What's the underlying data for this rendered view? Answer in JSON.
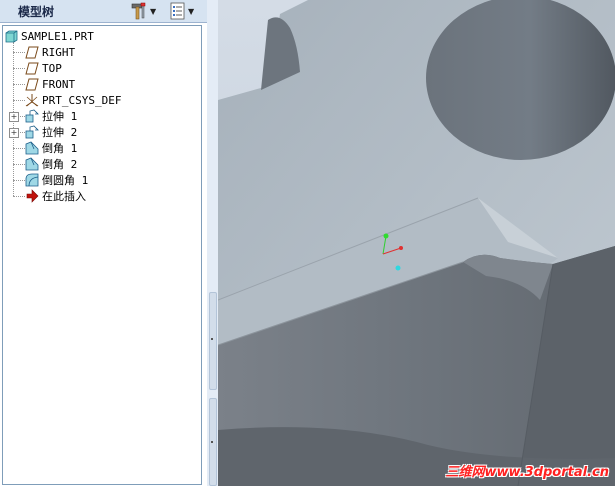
{
  "panel": {
    "title": "模型树",
    "tools_icon": "hammer-tools-icon",
    "settings_icon": "tree-settings-icon"
  },
  "tree": {
    "root": {
      "label": "SAMPLE1.PRT",
      "icon": "part-icon"
    },
    "items": [
      {
        "label": "RIGHT",
        "icon": "datum-plane-icon",
        "expandable": false
      },
      {
        "label": "TOP",
        "icon": "datum-plane-icon",
        "expandable": false
      },
      {
        "label": "FRONT",
        "icon": "datum-plane-icon",
        "expandable": false
      },
      {
        "label": "PRT_CSYS_DEF",
        "icon": "coordinate-system-icon",
        "expandable": false
      },
      {
        "label": "拉伸 1",
        "icon": "extrude-icon",
        "expandable": true
      },
      {
        "label": "拉伸 2",
        "icon": "extrude-icon",
        "expandable": true
      },
      {
        "label": "倒角 1",
        "icon": "chamfer-icon",
        "expandable": false
      },
      {
        "label": "倒角 2",
        "icon": "chamfer-icon",
        "expandable": false
      },
      {
        "label": "倒圆角 1",
        "icon": "round-icon",
        "expandable": false
      },
      {
        "label": "在此插入",
        "icon": "insert-here-arrow-icon",
        "expandable": false
      }
    ]
  },
  "colors": {
    "panel_header": "#d6e3f1",
    "model_top_face": "#b9c3cc",
    "model_side_face": "#6b727a",
    "watermark": "#ff2020"
  },
  "watermark": "三维网www.3dportal.cn"
}
